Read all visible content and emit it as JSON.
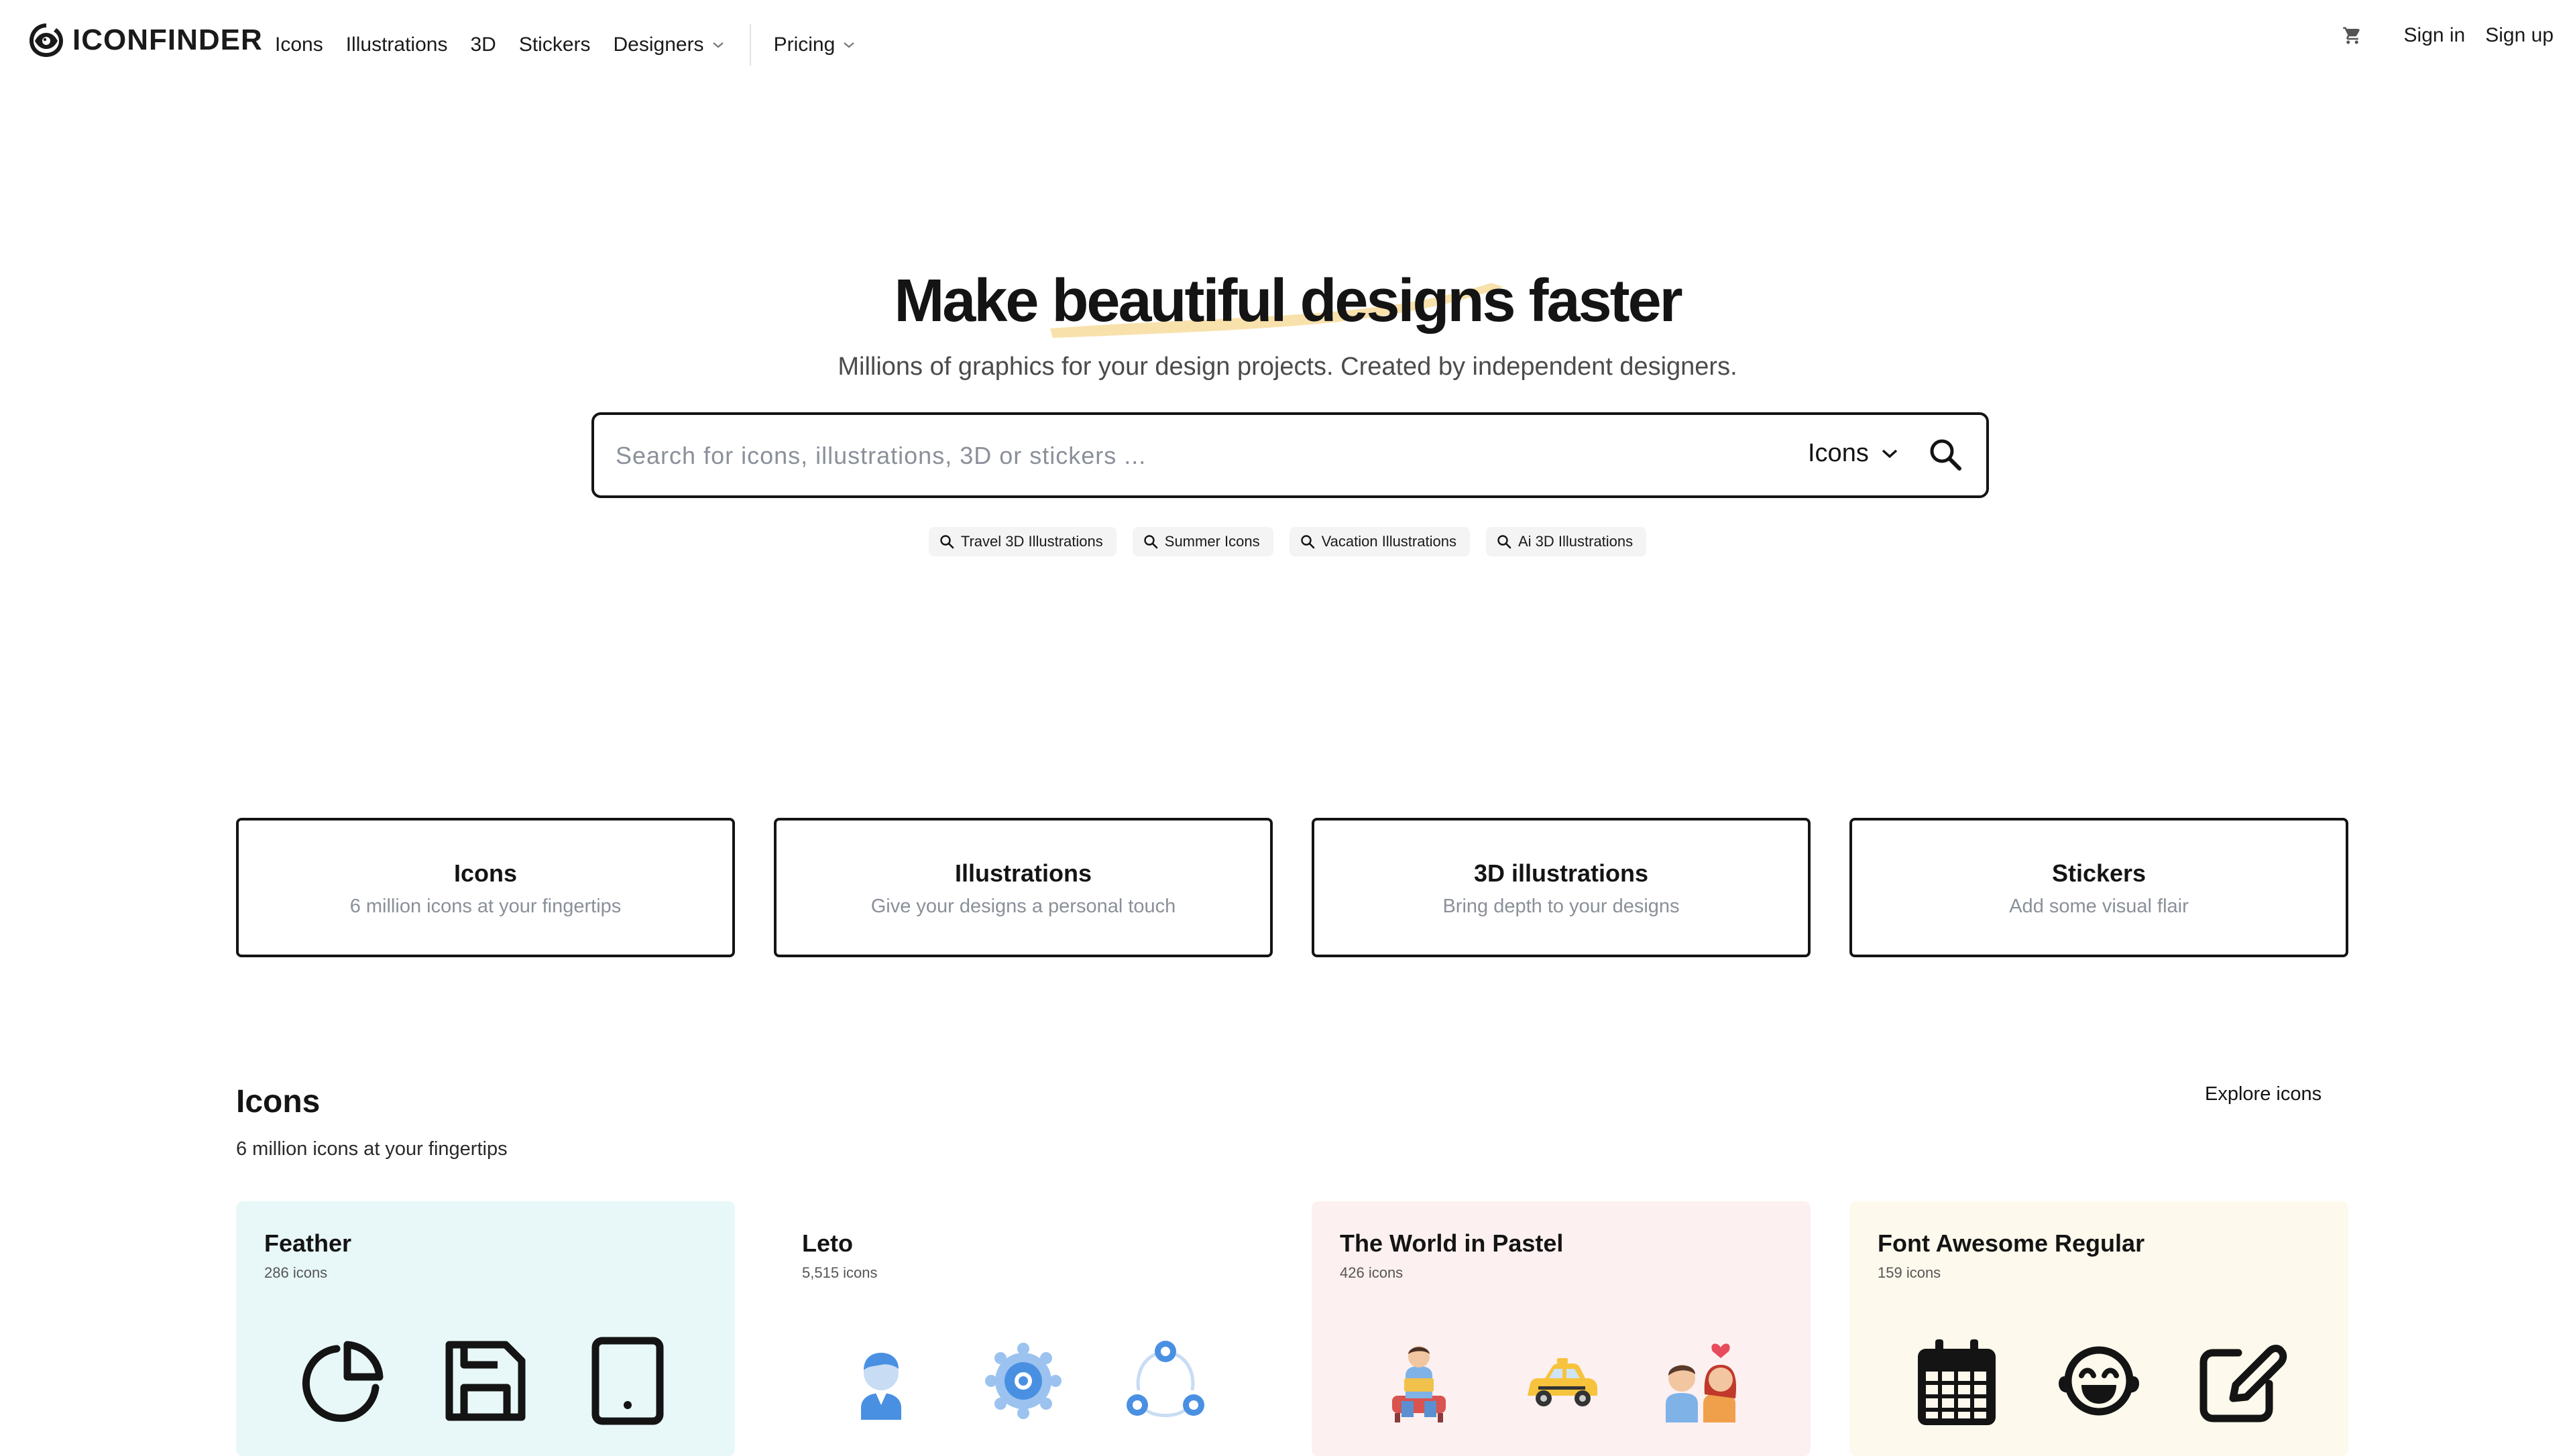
{
  "header": {
    "logo_text": "ICONFINDER",
    "nav": [
      "Icons",
      "Illustrations",
      "3D",
      "Stickers"
    ],
    "designers": "Designers",
    "pricing": "Pricing",
    "sign_in": "Sign in",
    "sign_up": "Sign up"
  },
  "hero": {
    "title_pre": "Make ",
    "title_hl": "beautiful designs",
    "title_post": " faster",
    "subtitle": "Millions of graphics for your design projects. Created by independent designers.",
    "search_placeholder": "Search for icons, illustrations, 3D or stickers ...",
    "search_type": "Icons",
    "chips": [
      "Travel 3D Illustrations",
      "Summer Icons",
      "Vacation Illustrations",
      "Ai 3D Illustrations"
    ]
  },
  "categories": [
    {
      "title": "Icons",
      "subtitle": "6 million icons at your fingertips"
    },
    {
      "title": "Illustrations",
      "subtitle": "Give your designs a personal touch"
    },
    {
      "title": "3D illustrations",
      "subtitle": "Bring depth to your designs"
    },
    {
      "title": "Stickers",
      "subtitle": "Add some visual flair"
    }
  ],
  "icons_section": {
    "title": "Icons",
    "subtitle": "6 million icons at your fingertips",
    "explore": "Explore icons"
  },
  "packs": [
    {
      "title": "Feather",
      "count": "286 icons",
      "bg": "#e8f8f8",
      "icons": [
        "pie-chart-icon",
        "save-icon",
        "tablet-icon"
      ]
    },
    {
      "title": "Leto",
      "count": "5,515 icons",
      "bg": "#ffffff",
      "icons": [
        "user-icon",
        "settings-icon",
        "network-icon"
      ]
    },
    {
      "title": "The World in Pastel",
      "count": "426 icons",
      "bg": "#fdf0f0",
      "icons": [
        "reading-person-icon",
        "taxi-icon",
        "couple-icon"
      ]
    },
    {
      "title": "Font Awesome Regular",
      "count": "159 icons",
      "bg": "#fdf9ec",
      "icons": [
        "calendar-icon",
        "laughing-face-icon",
        "edit-icon"
      ]
    }
  ],
  "colors": {
    "highlight": "#f7dc9c",
    "text": "#141414",
    "muted": "#8a9099",
    "leto_blue": "#4a90e2"
  }
}
